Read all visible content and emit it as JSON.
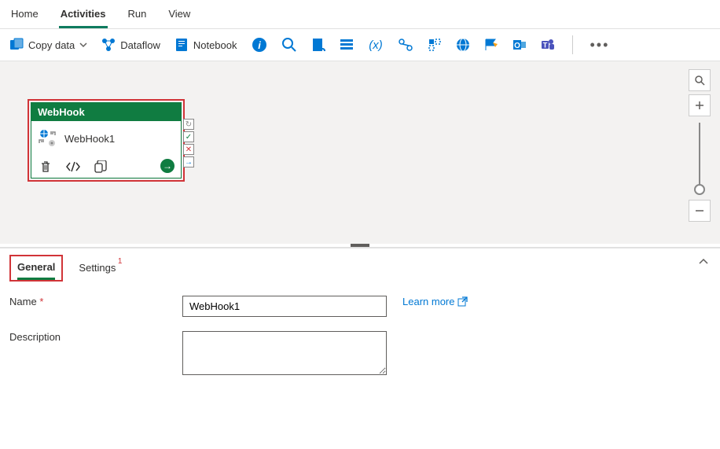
{
  "menu": {
    "tabs": [
      "Home",
      "Activities",
      "Run",
      "View"
    ],
    "active": 1
  },
  "toolbar": {
    "copydata": "Copy data",
    "dataflow": "Dataflow",
    "notebook": "Notebook"
  },
  "canvas": {
    "node": {
      "type": "WebHook",
      "name": "WebHook1"
    }
  },
  "props": {
    "tabs": {
      "general": "General",
      "settings": "Settings",
      "settings_badge": "1"
    },
    "form": {
      "name_label": "Name",
      "name_value": "WebHook1",
      "desc_label": "Description",
      "desc_value": "",
      "learn_more": "Learn more"
    }
  }
}
